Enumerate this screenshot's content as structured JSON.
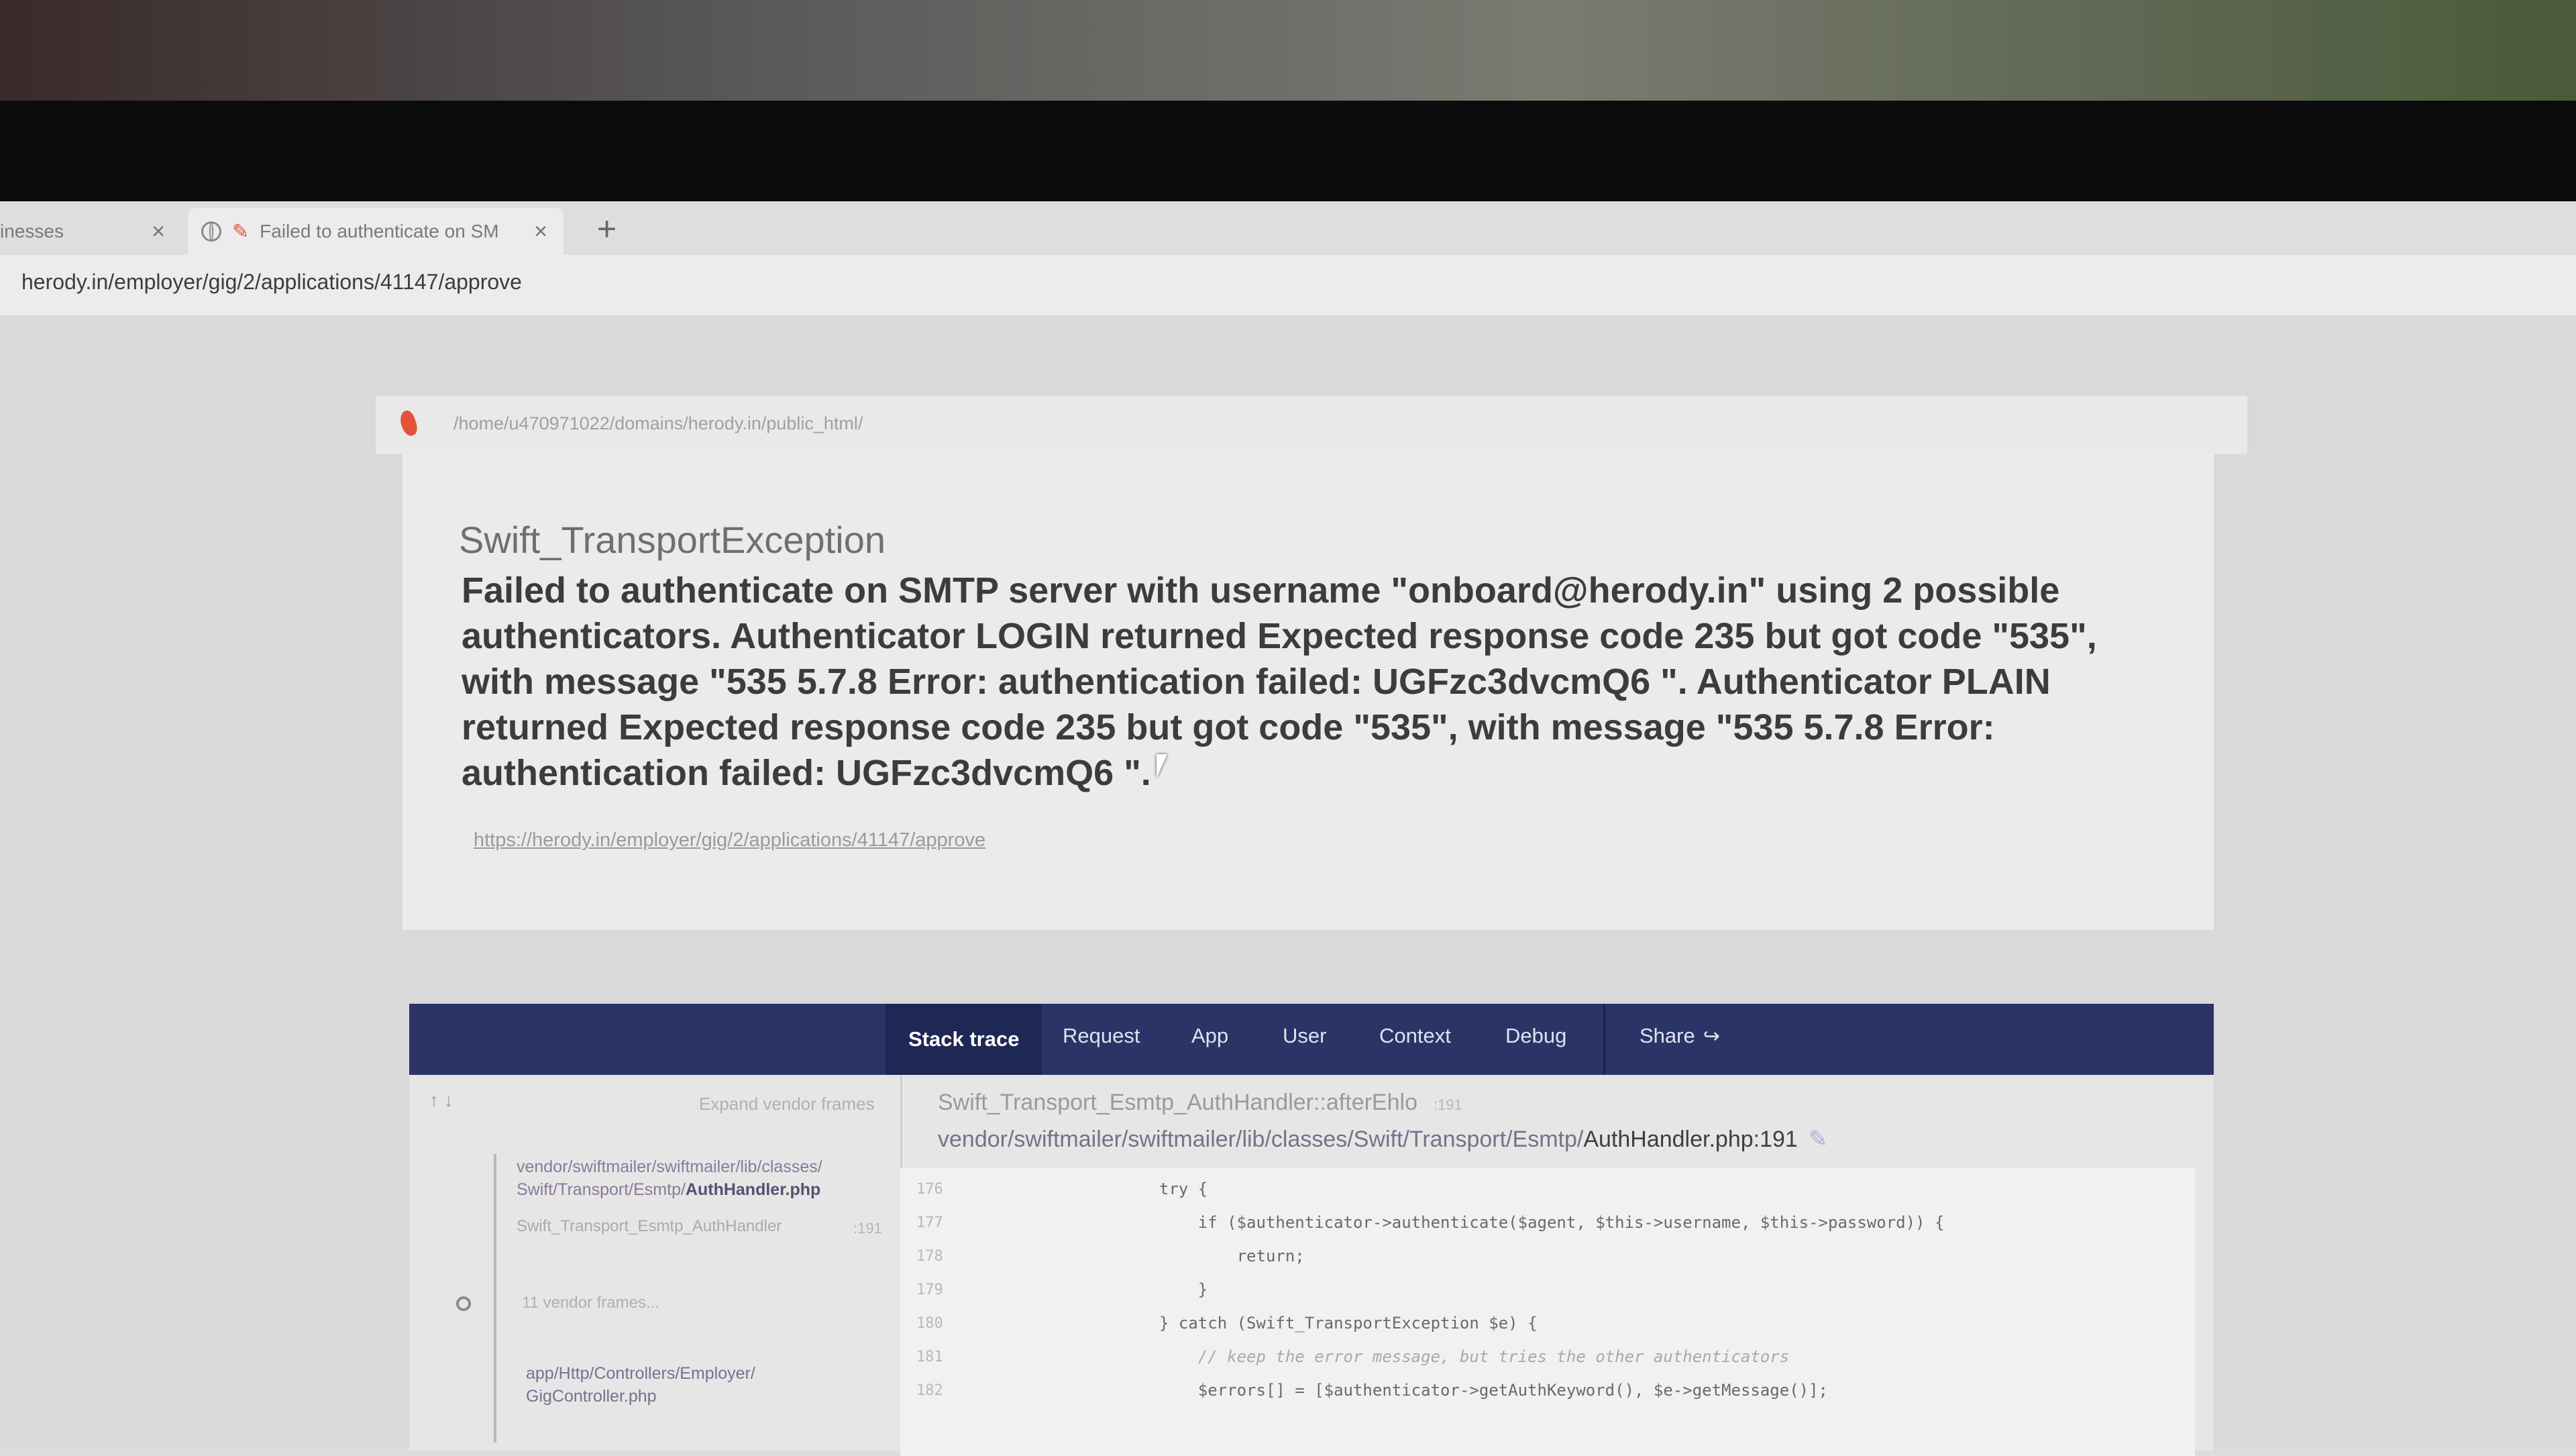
{
  "browser": {
    "tabs": [
      {
        "label": "inesses",
        "close": "×"
      },
      {
        "label": "Failed to authenticate on SM",
        "close": "×"
      }
    ],
    "new_tab": "+",
    "url": "herody.in/employer/gig/2/applications/41147/approve"
  },
  "error": {
    "base_path": "/home/u470971022/domains/herody.in/public_html/",
    "exception_class": "Swift_TransportException",
    "message": "Failed to authenticate on SMTP server with username \"onboard@herody.in\" using 2 possible authenticators. Authenticator LOGIN returned Expected response code 235 but got code \"535\", with message \"535 5.7.8 Error: authentication failed: UGFzc3dvcmQ6 \". Authenticator PLAIN returned Expected response code 235 but got code \"535\", with message \"535 5.7.8 Error: authentication failed: UGFzc3dvcmQ6 \".",
    "url": "https://herody.in/employer/gig/2/applications/41147/approve"
  },
  "nav": {
    "stack_trace": "Stack trace",
    "request": "Request",
    "app": "App",
    "user": "User",
    "context": "Context",
    "debug": "Debug",
    "share": "Share"
  },
  "trace": {
    "arrows": "↑ ↓",
    "expand_vendor": "Expand vendor frames",
    "frame1_path": "vendor/swiftmailer/swiftmailer/lib/classes/",
    "frame1_path2": "Swift/Transport/Esmtp/",
    "frame1_file": "AuthHandler.php",
    "frame1_fn": "Swift_Transport_Esmtp_AuthHandler",
    "frame1_line": ":191",
    "vendor_frames": "11 vendor frames...",
    "frame2_path": "app/Http/Controllers/Employer/",
    "frame2_file": "GigController.php",
    "function_title": "Swift_Transport_Esmtp_AuthHandler::afterEhlo",
    "function_line": ":191",
    "file_dir": "vendor/swiftmailer/swiftmailer/lib/classes/Swift/Transport/Esmtp/",
    "file_name": "AuthHandler.php:191"
  },
  "code": [
    {
      "line": "176",
      "text": "try {",
      "comment": false
    },
    {
      "line": "177",
      "text": "    if ($authenticator->authenticate($agent, $this->username, $this->password)) {",
      "comment": false
    },
    {
      "line": "178",
      "text": "        return;",
      "comment": false
    },
    {
      "line": "179",
      "text": "    }",
      "comment": false
    },
    {
      "line": "180",
      "text": "} catch (Swift_TransportException $e) {",
      "comment": false
    },
    {
      "line": "181",
      "text": "    // keep the error message, but tries the other authenticators",
      "comment": true
    },
    {
      "line": "182",
      "text": "    $errors[] = [$authenticator->getAuthKeyword(), $e->getMessage()];",
      "comment": false
    }
  ]
}
